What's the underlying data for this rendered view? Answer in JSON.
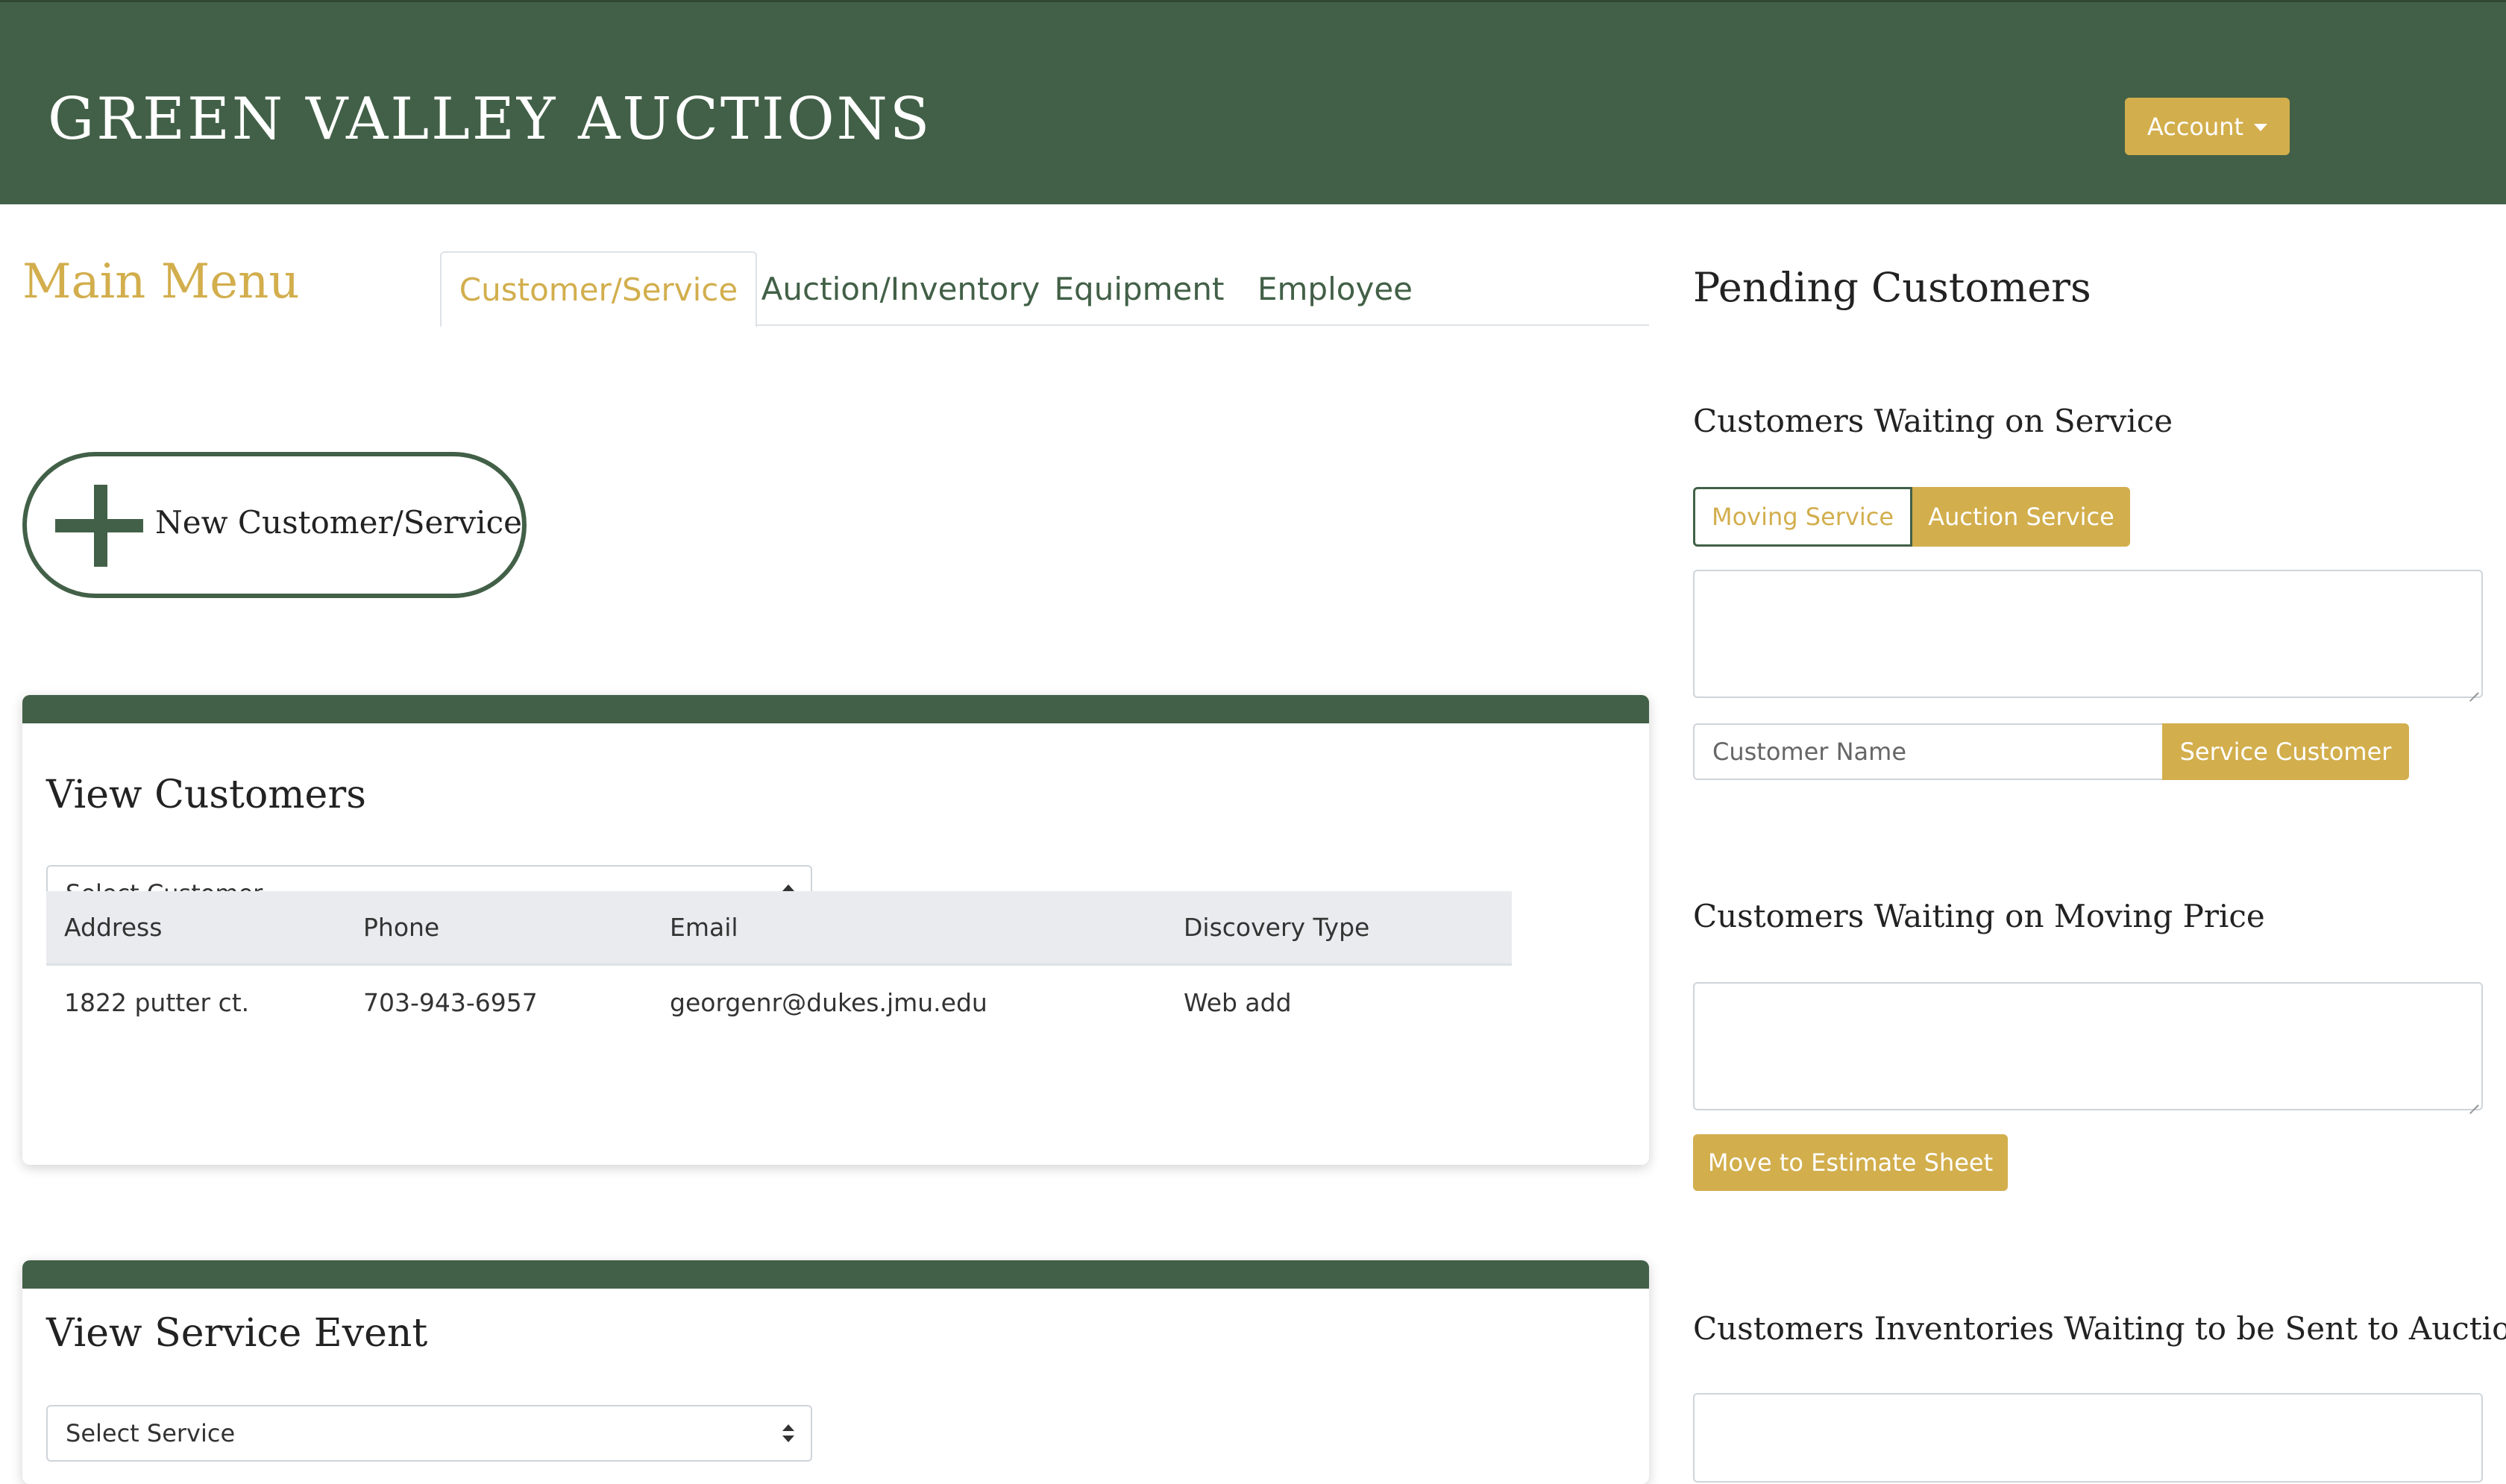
{
  "header": {
    "brand": "GREEN VALLEY AUCTIONS",
    "account_label": "Account",
    "colors": {
      "primary": "#426047",
      "accent": "#d2ae4d"
    }
  },
  "main_menu": {
    "title": "Main Menu",
    "tabs": [
      {
        "label": "Customer/Service",
        "active": true
      },
      {
        "label": "Auction/Inventory",
        "active": false
      },
      {
        "label": "Equipment",
        "active": false
      },
      {
        "label": "Employee",
        "active": false
      }
    ]
  },
  "new_customer": {
    "label": "New Customer/Service",
    "icon": "plus-icon"
  },
  "view_customers": {
    "title": "View Customers",
    "select_value": "Select Customer",
    "columns": [
      "Address",
      "Phone",
      "Email",
      "Discovery Type"
    ],
    "rows": [
      [
        "1822 putter ct.",
        "703-943-6957",
        "georgenr@dukes.jmu.edu",
        "Web add"
      ]
    ]
  },
  "view_service_event": {
    "title": "View Service Event",
    "select_value": "Select Service"
  },
  "pending": {
    "title": "Pending Customers",
    "waiting_service": {
      "title": "Customers Waiting on Service",
      "toggle_moving": "Moving Service",
      "toggle_auction": "Auction Service",
      "name_placeholder": "Customer Name",
      "service_button": "Service Customer"
    },
    "waiting_price": {
      "title": "Customers Waiting on Moving Price",
      "estimate_button": "Move to Estimate Sheet"
    },
    "waiting_auction": {
      "title": "Customers Inventories Waiting to be Sent to Auction"
    }
  }
}
